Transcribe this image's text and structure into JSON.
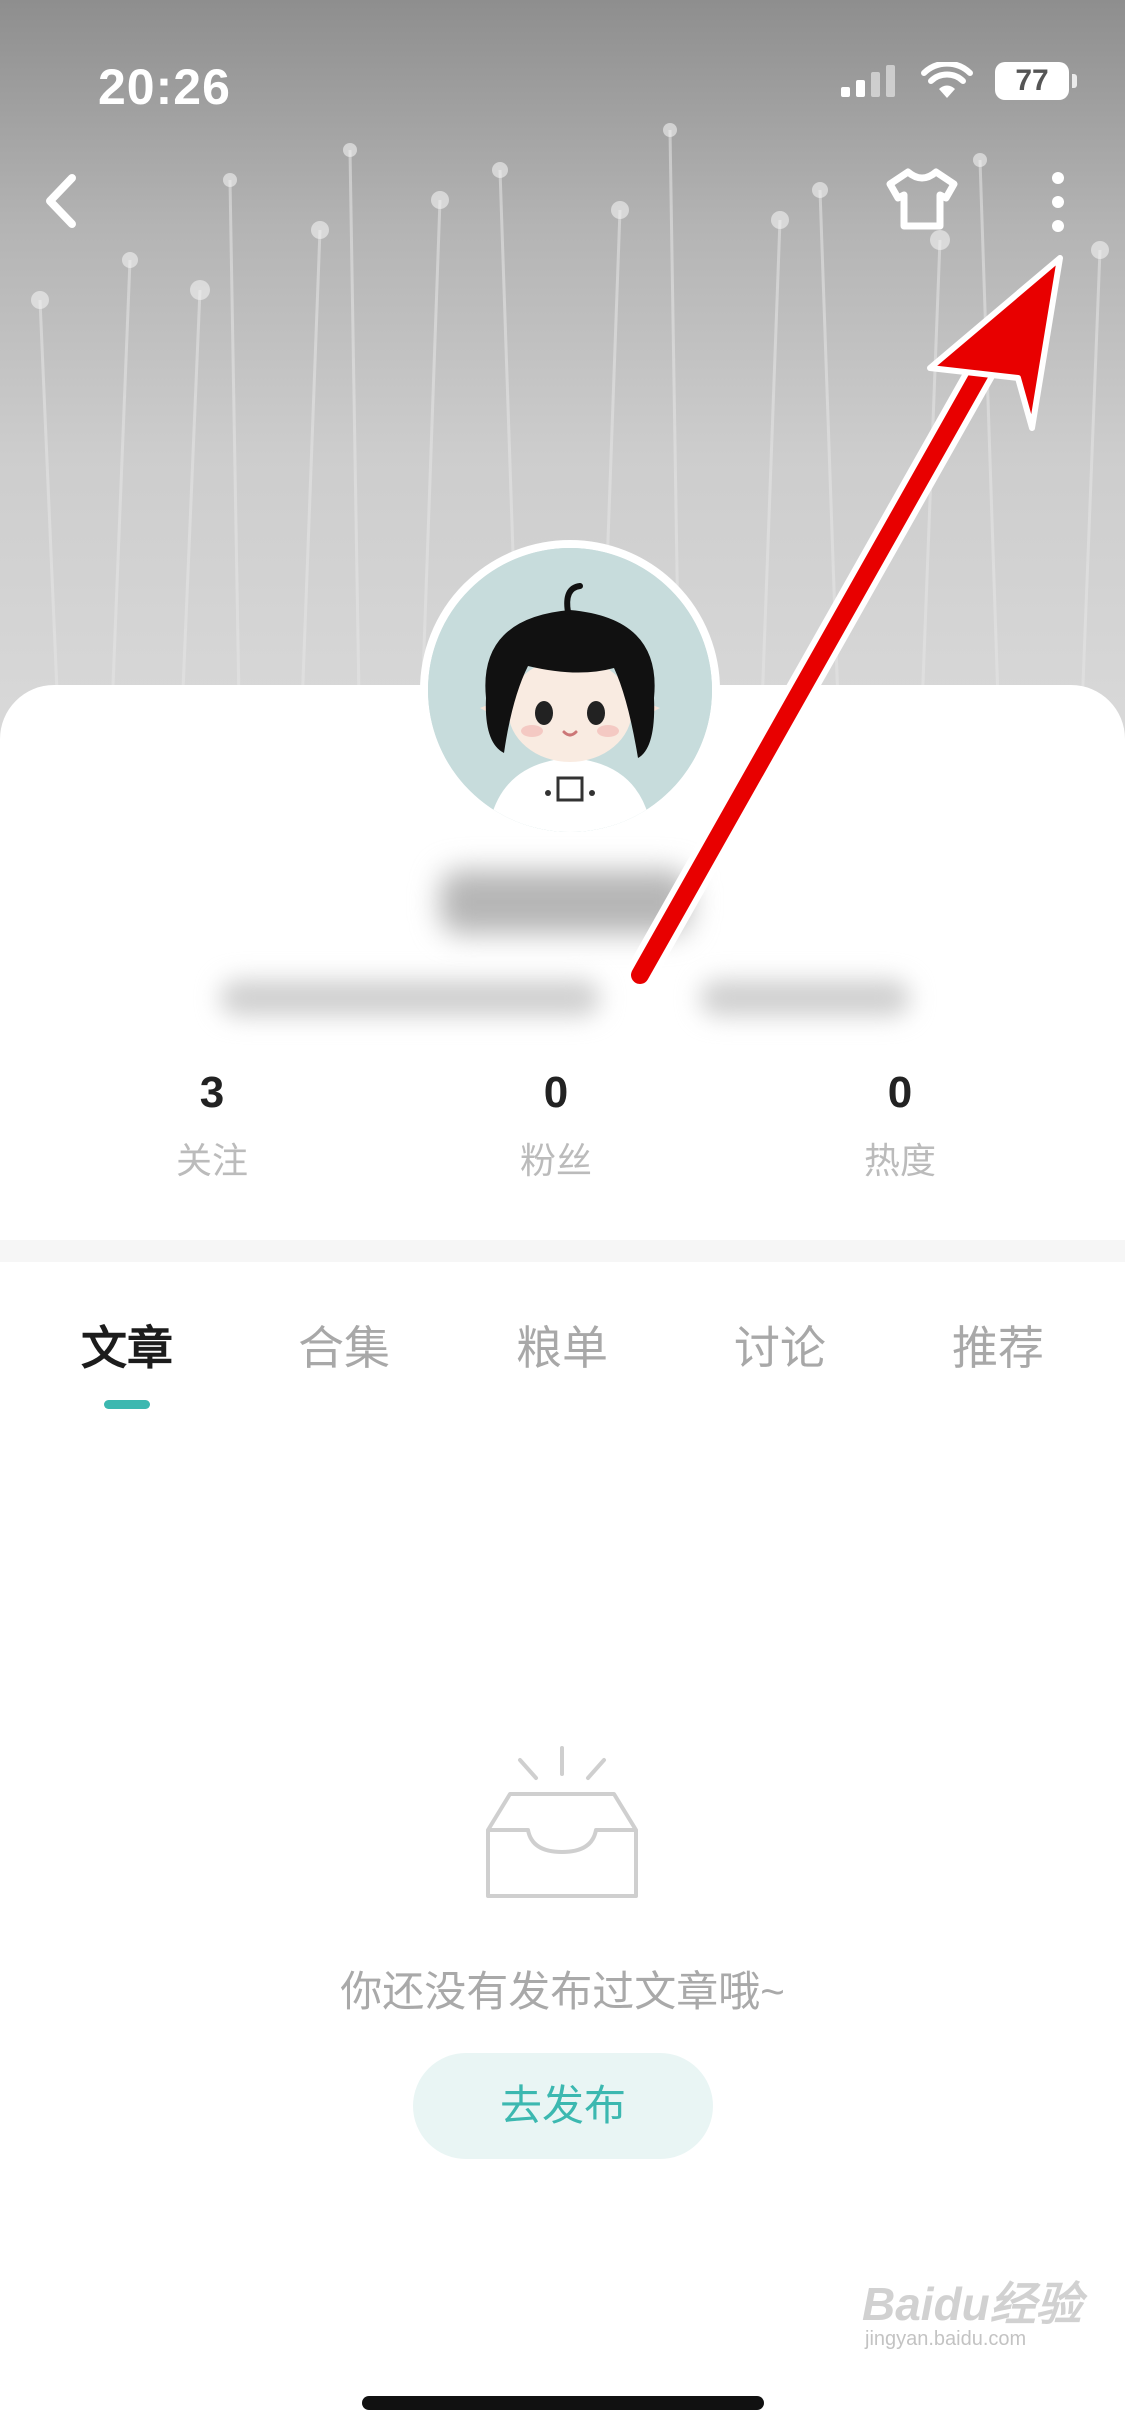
{
  "status_bar": {
    "time": "20:26",
    "battery": "77"
  },
  "nav": {
    "back_icon": "chevron-left-icon",
    "skin_icon": "tshirt-icon",
    "more_icon": "more-vertical-icon"
  },
  "stats": [
    {
      "value": "3",
      "label": "关注"
    },
    {
      "value": "0",
      "label": "粉丝"
    },
    {
      "value": "0",
      "label": "热度"
    }
  ],
  "tabs": [
    "文章",
    "合集",
    "粮单",
    "讨论",
    "推荐"
  ],
  "active_tab": "文章",
  "empty_state": {
    "message": "你还没有发布过文章哦~",
    "button_label": "去发布",
    "icon": "empty-inbox-icon"
  },
  "colors": {
    "accent": "#3cb8b0",
    "annotation_arrow": "#e80000"
  },
  "watermark": "Baidu经验",
  "watermark_url": "jingyan.baidu.com"
}
